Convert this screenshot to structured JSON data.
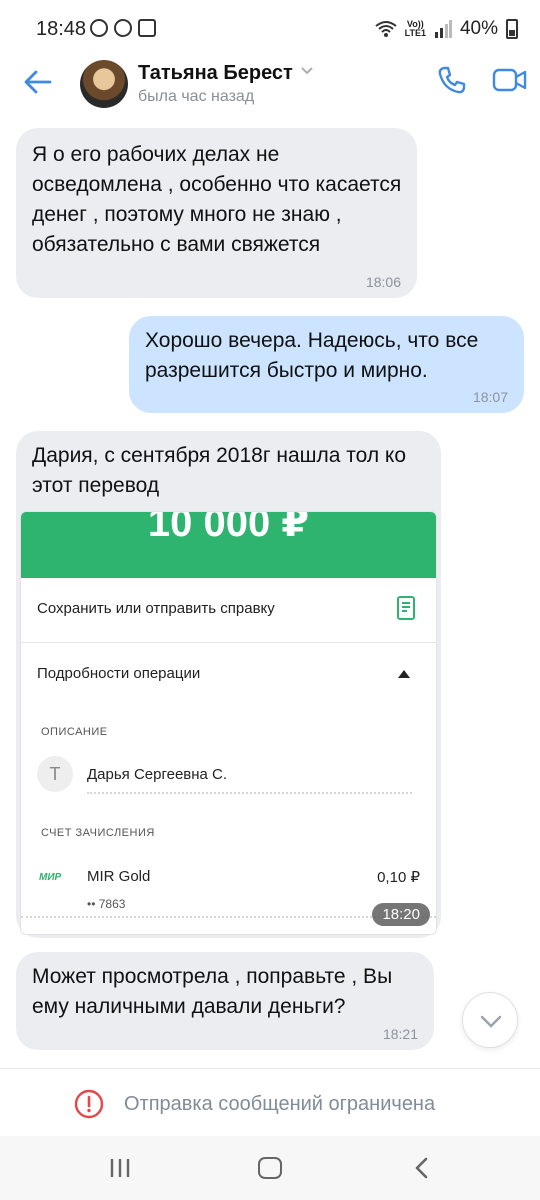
{
  "status_bar": {
    "time": "18:48",
    "network": "Vo))\nLTE1",
    "battery": "40%",
    "icons": [
      "no-disturb-icon",
      "whatsapp-icon",
      "gallery-icon",
      "wifi-icon",
      "signal-icon",
      "battery-icon"
    ]
  },
  "header": {
    "contact_name": "Татьяна Берест",
    "last_seen": "была час назад",
    "accent": "#3f8ae0"
  },
  "messages": [
    {
      "direction": "incoming",
      "text": "Я о его рабочих делах не осведомлена , особенно что касается денег , поэтому много не знаю  , обязательно с вами свяжется",
      "time": "18:06"
    },
    {
      "direction": "outgoing",
      "text": "Хорошо вечера. Надеюсь, что все разрешится быстро и мирно.",
      "time": "18:07"
    },
    {
      "direction": "incoming",
      "text": "Дария, с сентября 2018г нашла тол ко этот перевод",
      "time": "18:20",
      "attachment": {
        "amount": "10 000 ₽",
        "save_label": "Сохранить или отправить справку",
        "details_label": "Подробности операции",
        "description_caption": "ОПИСАНИЕ",
        "payer_initial": "Т",
        "payer_name": "Дарья Сергеевна С.",
        "account_caption": "СЧЕТ ЗАЧИСЛЕНИЯ",
        "card_logo": "МИР",
        "card_name": "MIR Gold",
        "card_number": "•• 7863",
        "card_amount": "0,10 ₽",
        "green": "#2fb470"
      }
    },
    {
      "direction": "incoming",
      "text": "Может просмотрела , поправьте , Вы ему наличными давали деньги?",
      "time": "18:21"
    }
  ],
  "footer": {
    "restricted_text": "Отправка сообщений ограничена",
    "alert_color": "#e64646"
  }
}
